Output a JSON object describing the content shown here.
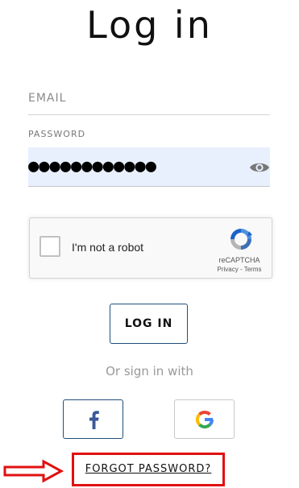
{
  "header": {
    "title": "Log in"
  },
  "form": {
    "email": {
      "placeholder": "EMAIL",
      "value": ""
    },
    "password": {
      "label": "PASSWORD",
      "value": "●●●●●●●●●●●●"
    }
  },
  "recaptcha": {
    "label": "I'm not a robot",
    "brand": "reCAPTCHA",
    "links": "Privacy - Terms"
  },
  "actions": {
    "login_label": "LOG IN",
    "alt_signin_text": "Or sign in with",
    "forgot_password_label": "FORGOT PASSWORD?"
  },
  "icons": {
    "eye": "eye-icon",
    "facebook": "facebook-icon",
    "google": "google-icon",
    "arrow": "arrow-right-icon"
  },
  "colors": {
    "accent": "#1f4f7a",
    "highlight": "#e01010",
    "password_fill": "#e8f0fe",
    "facebook": "#3b5998"
  }
}
